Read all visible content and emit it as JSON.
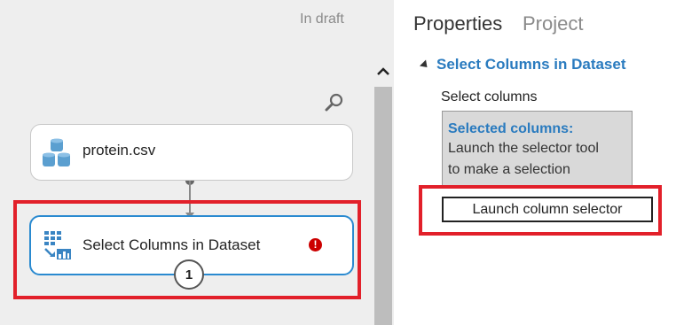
{
  "canvas": {
    "status": "In draft",
    "modules": [
      {
        "label": "protein.csv",
        "icon": "dataset-cylinders-icon"
      },
      {
        "label": "Select Columns in Dataset",
        "icon": "select-columns-icon",
        "error_glyph": "!",
        "port_label": "1"
      }
    ]
  },
  "panel": {
    "tabs": [
      "Properties",
      "Project"
    ],
    "section_title": "Select Columns in Dataset",
    "field_label": "Select columns",
    "selected_box": {
      "title": "Selected columns:",
      "line1": "Launch the selector tool",
      "line2": "to make a selection"
    },
    "launch_button": "Launch column selector"
  },
  "colors": {
    "accent_blue": "#2a7bbf",
    "selection_border": "#2a8ad0",
    "highlight_red": "#e2202a",
    "error_red": "#cc0000"
  }
}
